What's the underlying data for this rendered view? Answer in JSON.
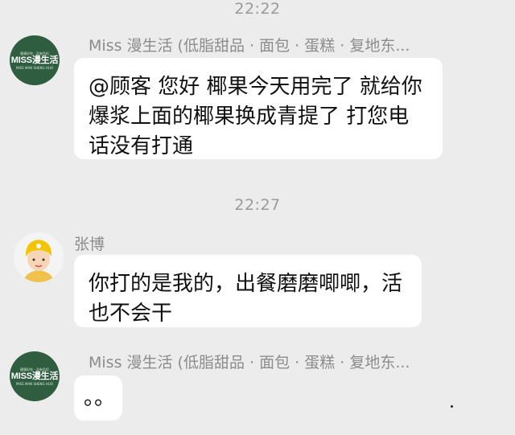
{
  "chat": {
    "timestamps": [
      "22:22",
      "22:27"
    ],
    "messages": [
      {
        "sender": "Miss 漫生活 (低脂甜品 · 面包 · 蛋糕 · 复地东...",
        "avatar_text": "MISS漫生活",
        "avatar_small_top": "健康好吃 · 没有负担",
        "avatar_small_bottom": "MISS MAN SHENG HUO",
        "text": "@顾客 您好 椰果今天用完了 就给你爆浆上面的椰果换成青提了 打您电话没有打通"
      },
      {
        "sender": "张博",
        "avatar": "cartoon-person-avatar",
        "text": "你打的是我的，出餐磨磨唧唧，活也不会干"
      },
      {
        "sender": "Miss 漫生活 (低脂甜品 · 面包 · 蛋糕 · 复地东...",
        "avatar_text": "MISS漫生活",
        "avatar_small_top": "健康好吃 · 没有负担",
        "avatar_small_bottom": "MISS MAN SHENG HUO",
        "text": "。。"
      }
    ]
  },
  "colors": {
    "background": "#ececec",
    "bubble": "#ffffff",
    "brand_avatar": "#2f5d40",
    "meta_text": "#8c8c8c"
  }
}
